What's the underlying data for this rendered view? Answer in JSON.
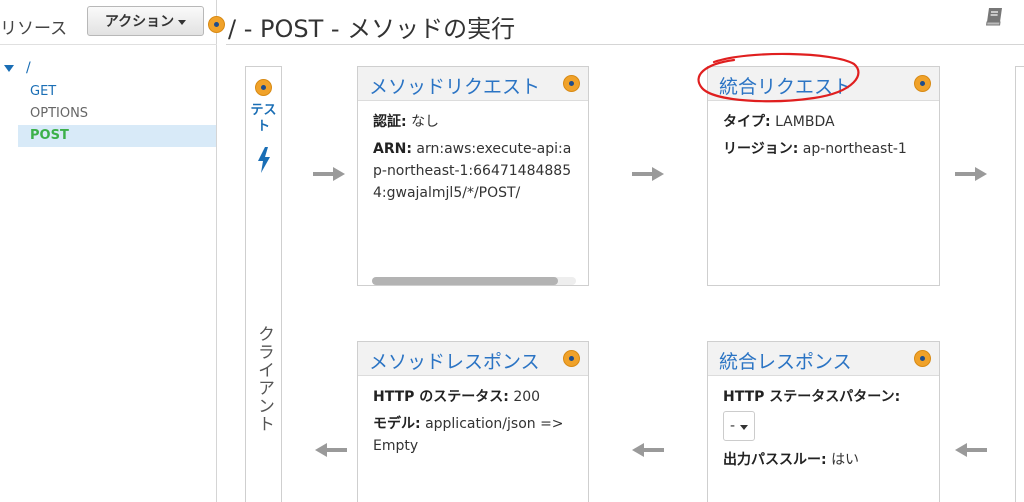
{
  "sidebar": {
    "title": "リソース",
    "action_button": "アクション",
    "root": "/",
    "methods": [
      "GET",
      "OPTIONS",
      "POST"
    ]
  },
  "header": {
    "title": "/ - POST - メソッドの実行"
  },
  "client": {
    "test_label": "テスト",
    "column_label": "クライアント"
  },
  "method_request": {
    "title": "メソッドリクエスト",
    "auth_label": "認証:",
    "auth_value": "なし",
    "arn_label": "ARN:",
    "arn_value": "arn:aws:execute-api:ap-northeast-1:664714848854:gwajalmjl5/*/POST/"
  },
  "integration_request": {
    "title": "統合リクエスト",
    "type_label": "タイプ:",
    "type_value": "LAMBDA",
    "region_label": "リージョン:",
    "region_value": "ap-northeast-1"
  },
  "method_response": {
    "title": "メソッドレスポンス",
    "status_label": "HTTP のステータス:",
    "status_value": "200",
    "model_label": "モデル:",
    "model_value": "application/json => Empty"
  },
  "integration_response": {
    "title": "統合レスポンス",
    "pattern_label": "HTTP ステータスパターン:",
    "pattern_value": "-",
    "passthrough_label": "出力パススルー:",
    "passthrough_value": "はい"
  },
  "icons": {
    "info": "info-dot-icon",
    "book": "book-icon",
    "bolt": "lightning-icon",
    "arrow_right": "arrow-right-icon",
    "arrow_left": "arrow-left-icon"
  },
  "colors": {
    "link_blue": "#2b74c4",
    "selected_green": "#3cb04a",
    "info_orange": "#f0a22a",
    "annotation_red": "#e01f1f"
  }
}
